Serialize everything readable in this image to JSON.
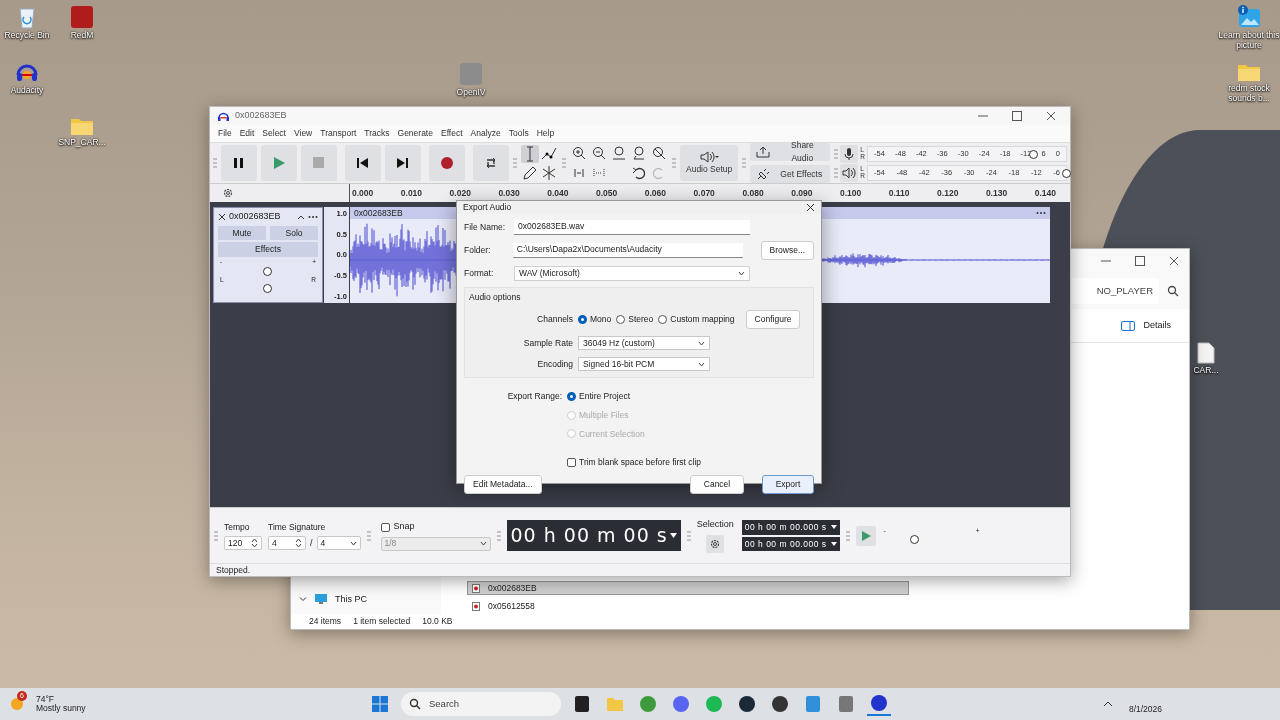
{
  "desktop": {
    "icons": [
      {
        "label": "Recycle Bin",
        "kind": "bin"
      },
      {
        "label": "RedM",
        "kind": "tile",
        "color": "#b01c1c"
      },
      {
        "label": "Audacity",
        "kind": "headphones"
      },
      {
        "label": "SNP_CAR...",
        "kind": "folder"
      },
      {
        "label": "OpenIV",
        "kind": "tile",
        "color": "#8c8c8c"
      },
      {
        "label": "Learn about this picture",
        "kind": "picture"
      },
      {
        "label": "redm stock sounds b...",
        "kind": "folder"
      },
      {
        "label": "CAR...",
        "kind": "document"
      }
    ]
  },
  "explorer": {
    "address": "NO_PLAYER",
    "view_button": "Details",
    "tree": [
      {
        "label": "This PC",
        "expanded": true
      }
    ],
    "files": [
      {
        "name": "0x002683EB",
        "selected": true
      },
      {
        "name": "0x05612558",
        "selected": false
      }
    ],
    "status": [
      "24 items",
      "1 item selected",
      "10.0 KB"
    ]
  },
  "audacity": {
    "title": "0x002683EB",
    "menu": [
      "File",
      "Edit",
      "Select",
      "View",
      "Transport",
      "Tracks",
      "Generate",
      "Effect",
      "Analyze",
      "Tools",
      "Help"
    ],
    "tools": [
      {
        "selected": true
      },
      {
        "selected": false
      },
      {
        "selected": false
      },
      {
        "selected": false
      }
    ],
    "audio_setup": "Audio Setup",
    "share_audio": "Share Audio",
    "get_effects": "Get Effects",
    "record_meter": {
      "channels": [
        "L",
        "R"
      ],
      "labels": [
        "-54",
        "-48",
        "-42",
        "-36",
        "-30",
        "-24",
        "-18",
        "-12",
        "6",
        "0"
      ],
      "level": 0.835
    },
    "playback_meter": {
      "channels": [
        "L",
        "R"
      ],
      "labels": [
        "-54",
        "-48",
        "-42",
        "-36",
        "-30",
        "-24",
        "-18",
        "-12",
        "-6"
      ],
      "level": 1.0
    },
    "ruler": [
      "0.000",
      "0.010",
      "0.020",
      "0.030",
      "0.040",
      "0.050",
      "0.060",
      "0.070",
      "0.080",
      "0.090",
      "0.100",
      "0.110",
      "0.120",
      "0.130",
      "0.140"
    ],
    "track": {
      "name": "0x002683EB",
      "mute": "Mute",
      "solo": "Solo",
      "effects": "Effects",
      "gain": {
        "labels": [
          "-",
          "+"
        ],
        "level": 0.5
      },
      "pan": {
        "labels": [
          "L",
          "R"
        ],
        "level": 0.5
      },
      "scale": [
        "1.0",
        "0.5",
        "0.0",
        "-0.5",
        "-1.0"
      ],
      "clip": "0x002683EB"
    },
    "bottom": {
      "tempo_label": "Tempo",
      "tempo": "120",
      "time_signature_label": "Time Signature",
      "beats": "4",
      "separator": "/",
      "beat_unit": "4",
      "snap": {
        "label": "Snap",
        "checked": false,
        "value": "1/8",
        "disabled": true
      },
      "time": "00 h 00 m 00 s",
      "selection_label": "Selection",
      "selection": [
        "00 h 00 m 00.000 s",
        "00 h 00 m 00.000 s"
      ],
      "play_speed": {
        "labels": [
          "-",
          "+"
        ],
        "level": 0.33
      }
    },
    "status": "Stopped."
  },
  "export_dialog": {
    "title": "Export Audio",
    "file_name_label": "File Name:",
    "file_name": "0x002683EB.wav",
    "folder_label": "Folder:",
    "folder": "C:\\Users\\Dapa2x\\Documents\\Audacity",
    "browse": "Browse...",
    "format_label": "Format:",
    "format": "WAV (Microsoft)",
    "audio_options": "Audio options",
    "channels_label": "Channels",
    "channels": [
      {
        "label": "Mono",
        "selected": true
      },
      {
        "label": "Stereo",
        "selected": false
      },
      {
        "label": "Custom mapping",
        "selected": false
      }
    ],
    "configure": "Configure",
    "sample_rate_label": "Sample Rate",
    "sample_rate": "36049 Hz (custom)",
    "encoding_label": "Encoding",
    "encoding": "Signed 16-bit PCM",
    "export_range_label": "Export Range:",
    "export_range": [
      {
        "label": "Entire Project",
        "selected": true,
        "disabled": false
      },
      {
        "label": "Multiple Files",
        "selected": false,
        "disabled": true
      },
      {
        "label": "Current Selection",
        "selected": false,
        "disabled": true
      }
    ],
    "trim": {
      "label": "Trim blank space before first clip",
      "checked": false
    },
    "edit_metadata": "Edit Metadata...",
    "cancel": "Cancel",
    "export": "Export"
  },
  "taskbar": {
    "weather": {
      "badge": "6",
      "temp": "74°F",
      "condition": "Mostly sunny"
    },
    "search": "Search",
    "date": "8/1/2026"
  }
}
